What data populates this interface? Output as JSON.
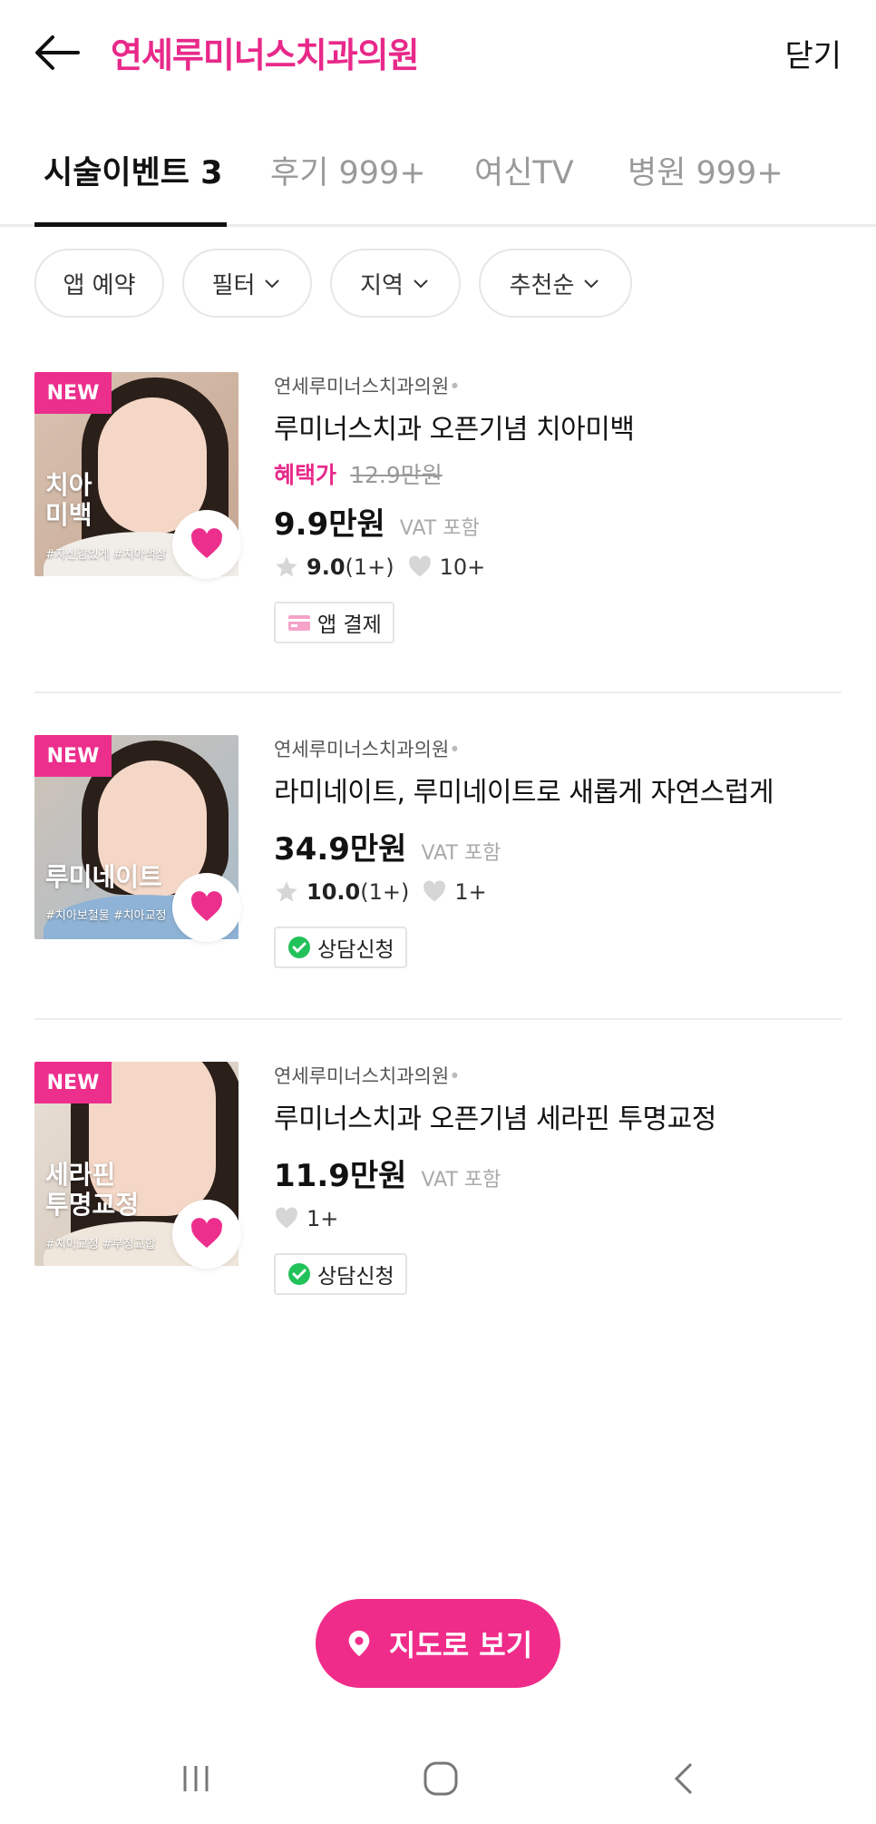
{
  "header": {
    "title": "연세루미너스치과의원",
    "close_label": "닫기"
  },
  "tabs": [
    {
      "label": "시술이벤트 3",
      "active": true
    },
    {
      "label": "후기 999+",
      "active": false
    },
    {
      "label": "여신TV",
      "active": false
    },
    {
      "label": "병원 999+",
      "active": false
    }
  ],
  "filters": [
    {
      "label": "앱 예약",
      "dropdown": false
    },
    {
      "label": "필터",
      "dropdown": true
    },
    {
      "label": "지역",
      "dropdown": true
    },
    {
      "label": "추천순",
      "dropdown": true
    }
  ],
  "events": [
    {
      "badge": "NEW",
      "thumb_title_1": "치아",
      "thumb_title_2": "미백",
      "thumb_tags": "#자신감있게 #치아색상",
      "clinic": "연세루미너스치과의원",
      "title": "루미너스치과 오픈기념 치아미백",
      "benefit_label": "혜택가",
      "original_price": "12.9만원",
      "price": "9.9만원",
      "vat": "VAT 포함",
      "rating": "9.0",
      "rating_count": "(1+)",
      "likes": "10+",
      "action_label": "앱 결제",
      "action_icon": "card-icon"
    },
    {
      "badge": "NEW",
      "thumb_title_1": "루미네이트",
      "thumb_title_2": "",
      "thumb_tags": "#치아보철물 #치아교정",
      "clinic": "연세루미너스치과의원",
      "title": "라미네이트, 루미네이트로 새롭게 자연스럽게",
      "price": "34.9만원",
      "vat": "VAT 포함",
      "rating": "10.0",
      "rating_count": "(1+)",
      "likes": "1+",
      "action_label": "상담신청",
      "action_icon": "chat-check-icon"
    },
    {
      "badge": "NEW",
      "thumb_title_1": "세라핀",
      "thumb_title_2": "투명교정",
      "thumb_tags": "#치아교정 #부정교합",
      "clinic": "연세루미너스치과의원",
      "title": "루미너스치과 오픈기념 세라핀 투명교정",
      "price": "11.9만원",
      "vat": "VAT 포함",
      "likes": "1+",
      "action_label": "상담신청",
      "action_icon": "chat-check-icon"
    }
  ],
  "map_button": {
    "label": "지도로 보기"
  },
  "colors": {
    "brand_pink": "#e8298a",
    "button_pink": "#f02c8a",
    "badge_pink": "#ec2f8d"
  }
}
